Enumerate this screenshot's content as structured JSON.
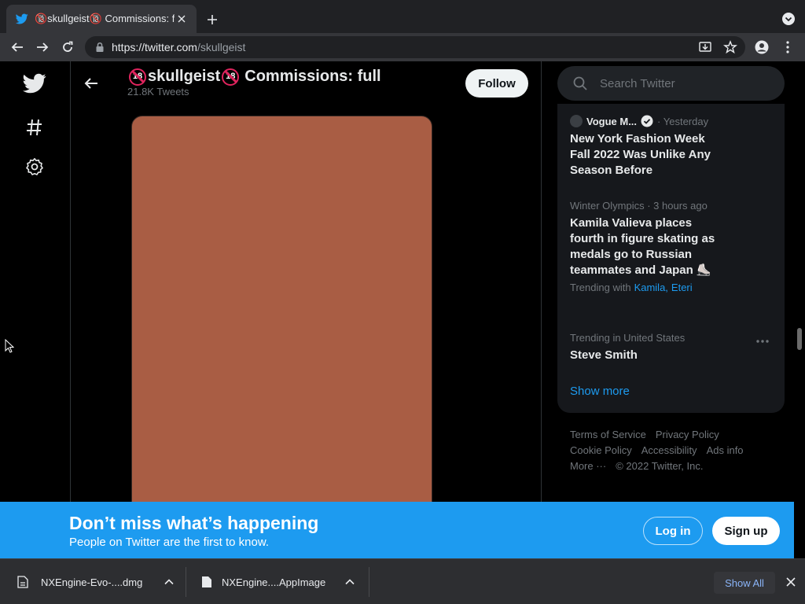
{
  "browser": {
    "tab_title": "🔞skullgeist🔞 Commissions: f",
    "url_domain": "https://twitter.com",
    "url_path": "/skullgeist"
  },
  "profile": {
    "name": "skullgeist",
    "name_suffix": "Commissions: full",
    "tweets_count": "21.8K Tweets",
    "follow_label": "Follow",
    "media_color": "#a95d44"
  },
  "search": {
    "placeholder": "Search Twitter"
  },
  "trends": [
    {
      "source": "Vogue M...",
      "time": "· Yesterday",
      "headline": "New York Fashion Week Fall 2022 Was Unlike Any Season Before"
    },
    {
      "meta": "Winter Olympics · 3 hours ago",
      "headline": "Kamila Valieva places fourth in figure skating as medals go to Russian teammates and Japan ⛸️",
      "trending_with_label": "Trending with",
      "trending_with": [
        "Kamila,",
        "Eteri"
      ]
    },
    {
      "meta": "Trending in United States",
      "headline": "Steve Smith"
    }
  ],
  "show_more": "Show more",
  "footer": {
    "links": [
      "Terms of Service",
      "Privacy Policy",
      "Cookie Policy",
      "Accessibility",
      "Ads info",
      "More ···",
      "© 2022 Twitter, Inc."
    ]
  },
  "banner": {
    "title": "Don’t miss what’s happening",
    "subtitle": "People on Twitter are the first to know.",
    "login_label": "Log in",
    "signup_label": "Sign up"
  },
  "downloads": {
    "items": [
      "NXEngine-Evo-....dmg",
      "NXEngine....AppImage"
    ],
    "show_all": "Show All"
  },
  "colors": {
    "twitter_blue": "#1d9bf0",
    "age_badge": "#e0245e"
  },
  "icons": [
    "twitter-bird-icon",
    "hashtag-icon",
    "gear-icon",
    "back-arrow-icon",
    "search-icon",
    "verified-icon",
    "more-icon",
    "file-icon",
    "chevron-up-icon",
    "close-icon",
    "lock-icon",
    "star-icon",
    "account-icon",
    "install-icon",
    "kebab-icon",
    "reload-icon"
  ]
}
